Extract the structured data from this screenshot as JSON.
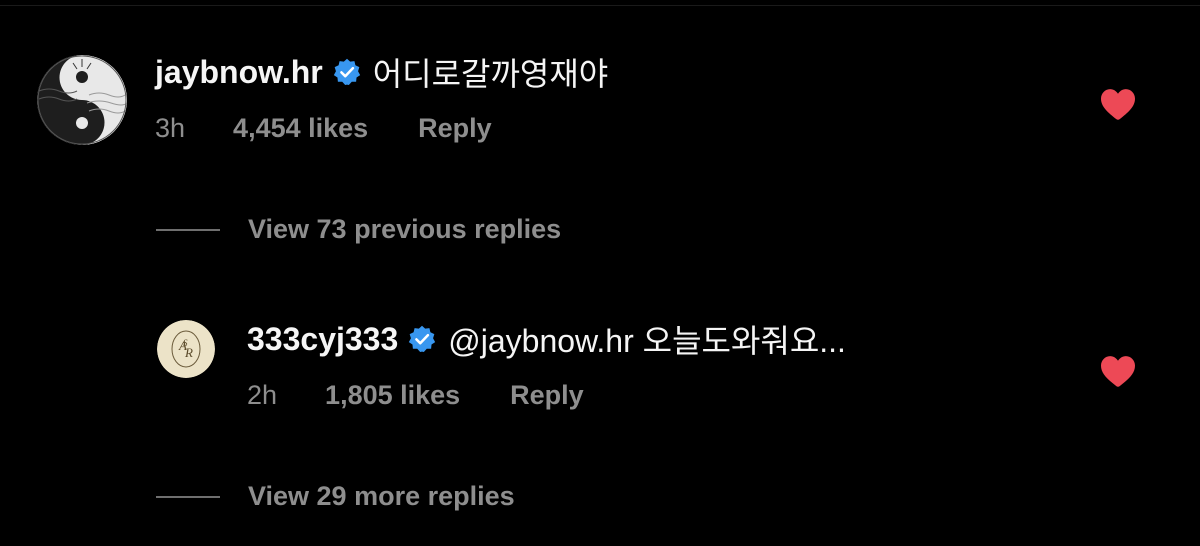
{
  "comments": [
    {
      "username": "jaybnow.hr",
      "verified": true,
      "text": "어디로갈까영재야",
      "time": "3h",
      "likes": "4,454 likes",
      "reply_label": "Reply",
      "liked": true,
      "avatar_icon": "yin-yang-avatar-icon"
    },
    {
      "username": "333cyj333",
      "verified": true,
      "text": "@jaybnow.hr 오늘도와줘요...",
      "time": "2h",
      "likes": "1,805 likes",
      "reply_label": "Reply",
      "liked": true,
      "avatar_icon": "monogram-avatar-icon"
    }
  ],
  "view_previous_replies": "View 73 previous replies",
  "view_more_replies": "View 29 more replies",
  "colors": {
    "background": "#000000",
    "text_primary": "#f5f5f5",
    "text_secondary": "#8e8e8e",
    "verified_blue": "#3897f0",
    "heart_red": "#ed4956"
  }
}
